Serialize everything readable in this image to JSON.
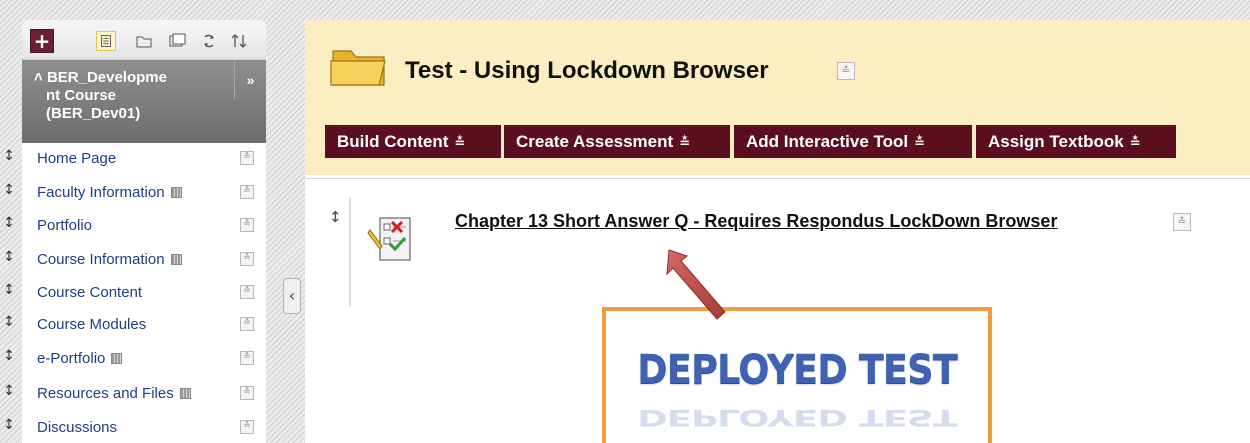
{
  "sidebar": {
    "add_label": "+",
    "toolbar_icons": [
      "list-view-icon",
      "folder-view-icon",
      "window-view-icon",
      "refresh-icon",
      "sort-icon"
    ],
    "course": {
      "title_lines": [
        "BER_Developme",
        "nt Course",
        "(BER_Dev01)"
      ],
      "collapse_glyph": "˄",
      "expand_glyph": "»"
    },
    "items": [
      {
        "label": "Home Page",
        "has_mini_icon": false
      },
      {
        "label": "Faculty Information",
        "has_mini_icon": true
      },
      {
        "label": "Portfolio",
        "has_mini_icon": false
      },
      {
        "label": "Course Information",
        "has_mini_icon": true
      },
      {
        "label": "Course Content",
        "has_mini_icon": false
      },
      {
        "label": "Course Modules",
        "has_mini_icon": false
      },
      {
        "label": "e-Portfolio",
        "has_mini_icon": true
      },
      {
        "label": "Resources and Files",
        "has_mini_icon": true
      },
      {
        "label": "Discussions",
        "has_mini_icon": false
      }
    ]
  },
  "content": {
    "page_title": "Test - Using Lockdown Browser",
    "action_bar": [
      {
        "label": "Build Content"
      },
      {
        "label": "Create Assessment"
      },
      {
        "label": "Add Interactive Tool"
      },
      {
        "label": "Assign Textbook"
      }
    ],
    "item": {
      "link": "Chapter 13 Short Answer Q - Requires Respondus LockDown Browser",
      "icon": "test-icon"
    }
  },
  "callout": {
    "text": "DEPLOYED TEST"
  },
  "colors": {
    "nav_link": "#1f3e88",
    "action_bar_bg": "#5a0e1f",
    "header_bg": "#fbeec2",
    "callout_border": "#f39a3c",
    "callout_text": "#3f63b2",
    "arrow": "#c0504d"
  }
}
